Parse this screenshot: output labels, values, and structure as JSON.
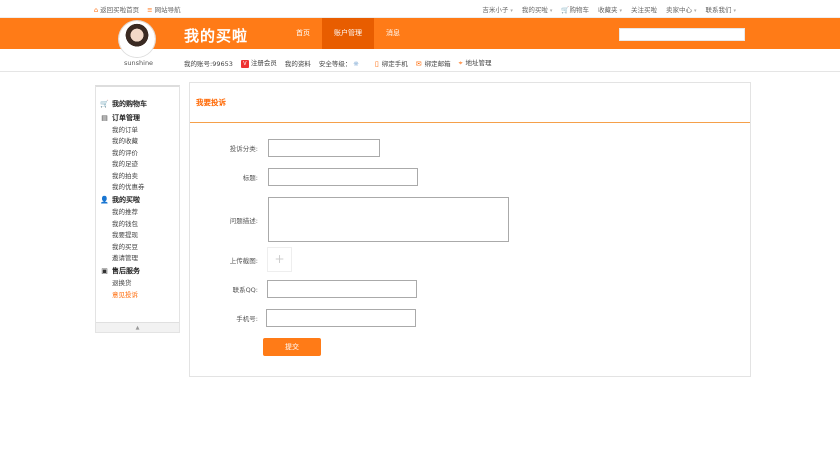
{
  "topbar": {
    "home_link": "返回买啦首页",
    "site_nav": "网站导航",
    "user": "吉米小子",
    "my_buy": "我的买啦",
    "cart": "购物车",
    "favorites": "收藏夹",
    "follow": "关注买啦",
    "seller_center": "卖家中心",
    "contact": "联系我们"
  },
  "header": {
    "brand": "我的买啦",
    "tabs": [
      "首页",
      "账户管理",
      "消息"
    ],
    "active_tab": 1
  },
  "subbar": {
    "username": "sunshine",
    "account_label": "我的账号:99653",
    "member": "注册会员",
    "profile": "我的资料",
    "security": "安全等级：",
    "bind_phone": "绑定手机",
    "bind_email": "绑定邮箱",
    "address": "地址管理"
  },
  "sidebar": {
    "groups": [
      {
        "title": "我的购物车",
        "items": []
      },
      {
        "title": "订单管理",
        "items": [
          "我的订单",
          "我的收藏",
          "我的评价",
          "我的足迹",
          "我的拍卖",
          "我的优惠券"
        ]
      },
      {
        "title": "我的买啦",
        "items": [
          "我的推荐",
          "我的钱包",
          "我要提现",
          "我的买豆",
          "邀请管理"
        ]
      },
      {
        "title": "售后服务",
        "items": [
          "退换货",
          "意见投诉"
        ]
      }
    ]
  },
  "form": {
    "title": "我要投诉",
    "category_label": "投诉分类:",
    "title_label": "标题:",
    "desc_label": "问题描述:",
    "upload_label": "上传截图:",
    "qq_label": "联系QQ:",
    "phone_label": "手机号:",
    "submit": "提交"
  }
}
